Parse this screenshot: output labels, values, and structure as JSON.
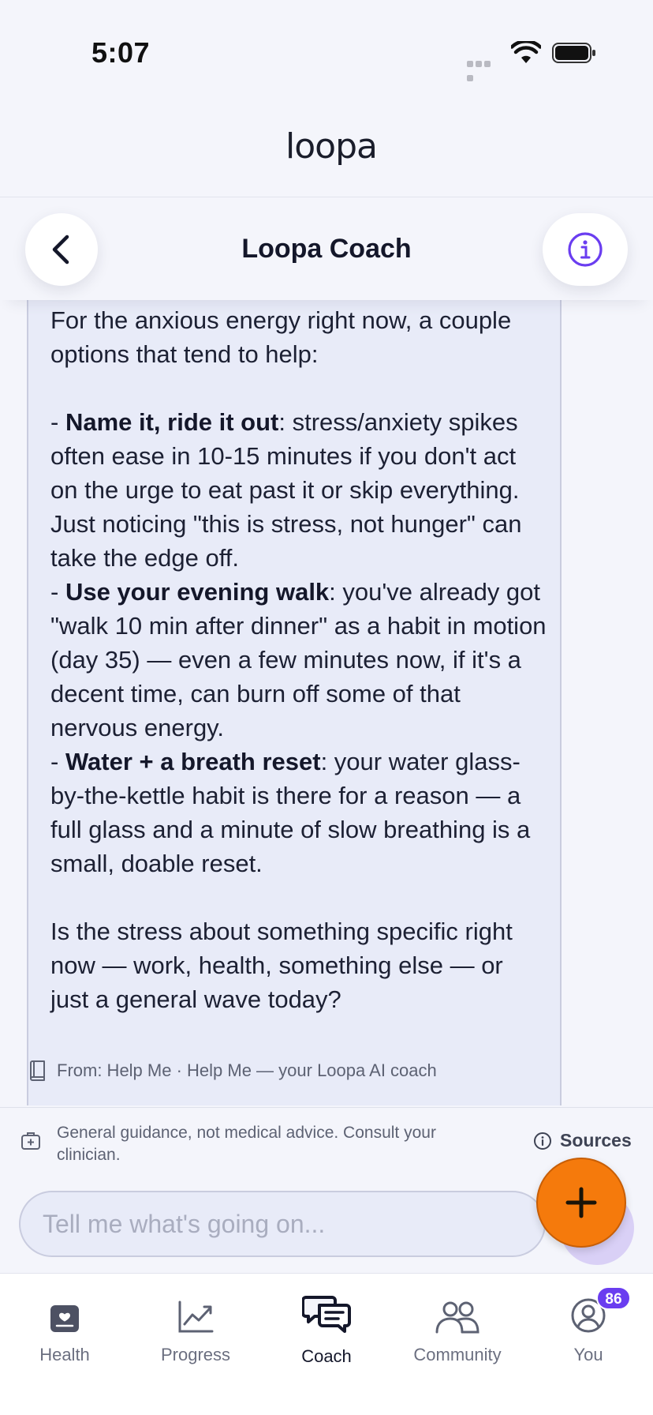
{
  "status_bar": {
    "time": "5:07"
  },
  "header": {
    "logo": "loopa",
    "title": "Loopa Coach"
  },
  "message": {
    "intro": "For the anxious energy right now, a couple options that tend to help:",
    "bullets": [
      {
        "prefix": "- ",
        "bold": "Name it, ride it out",
        "text": ": stress/anxiety spikes often ease in 10-15 minutes if you don't act on the urge to eat past it or skip everything. Just noticing \"this is stress, not hunger\" can take the edge off."
      },
      {
        "prefix": "- ",
        "bold": "Use your evening walk",
        "text": ": you've already got \"walk 10 min after dinner\" as a habit in motion (day 35) — even a few minutes now, if it's a decent time, can burn off some of that nervous energy."
      },
      {
        "prefix": "- ",
        "bold": "Water + a breath reset",
        "text": ": your water glass-by-the-kettle habit is there for a reason — a full glass and a minute of slow breathing is a small, doable reset."
      }
    ],
    "question": "Is the stress about something specific right now — work, health, something else — or just a general wave today?",
    "source": "From: Help Me · Help Me — your Loopa AI coach"
  },
  "disclaimer": {
    "text": "General guidance, not medical advice. Consult your clinician.",
    "sources_label": "Sources"
  },
  "composer": {
    "placeholder": "Tell me what's going on..."
  },
  "tabs": [
    {
      "label": "Health",
      "icon": "health-icon"
    },
    {
      "label": "Progress",
      "icon": "progress-icon"
    },
    {
      "label": "Coach",
      "icon": "coach-icon",
      "active": true
    },
    {
      "label": "Community",
      "icon": "community-icon"
    },
    {
      "label": "You",
      "icon": "profile-icon",
      "badge": "86"
    }
  ],
  "colors": {
    "accent": "#6a3df0",
    "fab": "#f57a0c",
    "bubble": "#e8ebf8"
  }
}
